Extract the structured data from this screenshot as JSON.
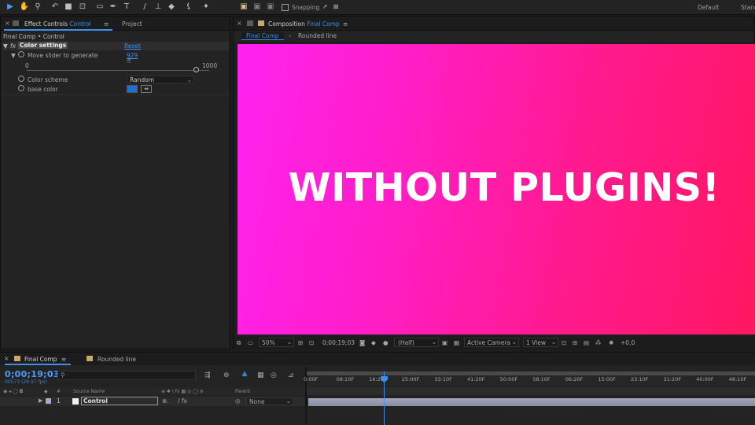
{
  "toolbar": {
    "snapping_label": "Snapping",
    "workspaces": [
      "Default",
      "Stand"
    ]
  },
  "effect_controls": {
    "tab_prefix": "Effect Controls",
    "tab_layer": "Control",
    "project_tab": "Project",
    "breadcrumb": "Final Comp • Control",
    "effect_name": "Color settings",
    "reset_label": "Reset",
    "slider_label": "Move slider to generate",
    "slider_value": "929",
    "slider_min_label": "0",
    "slider_max_label": "1000",
    "slider_fraction": 0.929,
    "scheme_label": "Color scheme",
    "scheme_value": "Random",
    "base_color_label": "base color",
    "base_color_hex": "#1f6fd6"
  },
  "composition": {
    "tab_prefix": "Composition",
    "tab_name": "Final Comp",
    "sub_tabs": [
      "Final Comp",
      "Rounded line"
    ],
    "canvas_text": "WITHOUT PLUGINS!",
    "zoom": "50%",
    "timecode": "0;00;19;03",
    "resolution": "(Half)",
    "camera": "Active Camera",
    "view": "1 View",
    "exposure": "+0,0"
  },
  "timeline": {
    "tabs": [
      "Final Comp",
      "Rounded line"
    ],
    "current_time": "0;00;19;03",
    "frame_info": "00573 (29.97 fps)",
    "search_placeholder": "",
    "ruler_ticks": [
      "0:00F",
      "08:10F",
      "16:20F",
      "25:00F",
      "33:10F",
      "41:20F",
      "50:00F",
      "58:10F",
      "06:20F",
      "15:00F",
      "23:10F",
      "31:20F",
      "40:00F",
      "48:10F"
    ],
    "col_source_name": "Source Name",
    "col_parent": "Parent",
    "layer_number": "1",
    "layer_name": "Control",
    "layer_parent": "None"
  },
  "colors": {
    "accent": "#3d8fe8",
    "canvas_left": "#ff22f0",
    "canvas_right": "#ff1760"
  }
}
